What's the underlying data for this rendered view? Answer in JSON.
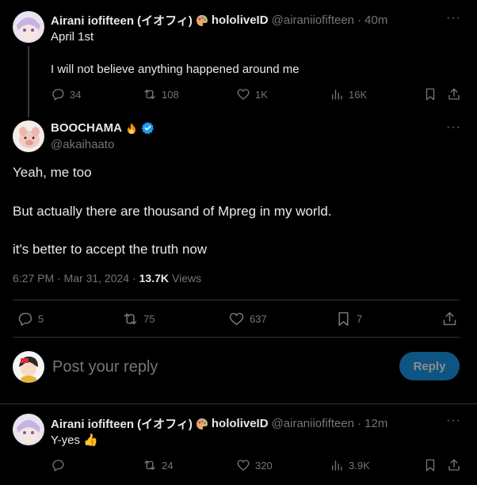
{
  "post1": {
    "author_name": "Airani iofifteen (イオフィ)",
    "author_suffix": "hololiveID",
    "handle": "@airaniiofifteen",
    "time": "· 40m",
    "line1": "April 1st",
    "line2": "I will not believe anything happened around me",
    "stats": {
      "replies": "34",
      "reposts": "108",
      "likes": "1K",
      "views": "16K"
    }
  },
  "main_post": {
    "author_name": "BOOCHAMA",
    "handle": "@akaihaato",
    "para1": "Yeah, me too",
    "para2": "But actually there are thousand of Mpreg in my world.",
    "para3": "it's better to accept the truth now",
    "timestamp": "6:27 PM · Mar 31, 2024 ·",
    "views_count": "13.7K",
    "views_label": "Views",
    "stats": {
      "replies": "5",
      "reposts": "75",
      "likes": "637",
      "bookmarks": "7"
    }
  },
  "composer": {
    "placeholder": "Post your reply",
    "button_label": "Reply"
  },
  "post3": {
    "author_name": "Airani iofifteen (イオフィ)",
    "author_suffix": "hololiveID",
    "handle": "@airaniiofifteen",
    "time": "· 12m",
    "text": "Y-yes 👍",
    "stats": {
      "reposts": "24",
      "likes": "320",
      "views": "3.9K"
    }
  },
  "colors": {
    "accent": "#1d9bf0",
    "muted": "#71767b",
    "text": "#e7e9ea",
    "border": "#2f3336"
  },
  "icons": [
    "more-icon",
    "reply-icon",
    "repost-icon",
    "like-icon",
    "views-icon",
    "bookmark-icon",
    "share-icon",
    "verified-badge-icon",
    "palette-emoji-icon",
    "fire-emoji-icon"
  ]
}
